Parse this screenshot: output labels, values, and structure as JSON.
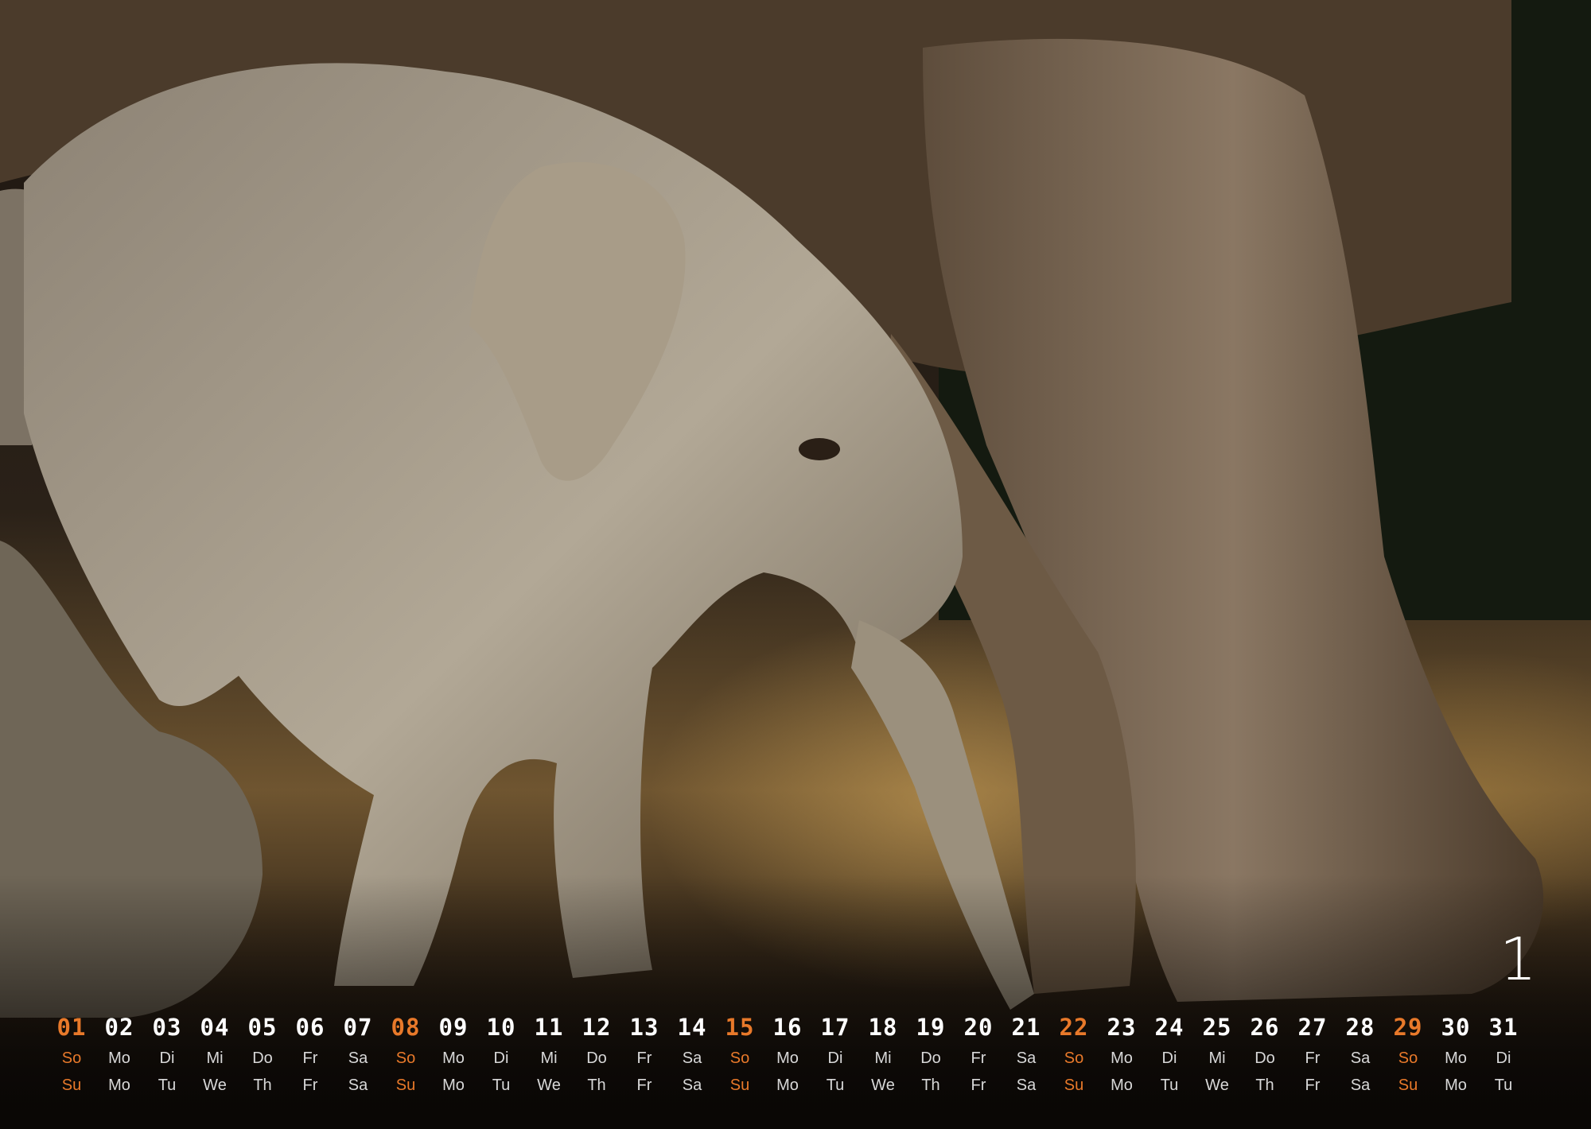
{
  "month_number": "1",
  "days": [
    {
      "num": "01",
      "de": "So",
      "en": "Su"
    },
    {
      "num": "02",
      "de": "Mo",
      "en": "Mo"
    },
    {
      "num": "03",
      "de": "Di",
      "en": "Tu"
    },
    {
      "num": "04",
      "de": "Mi",
      "en": "We"
    },
    {
      "num": "05",
      "de": "Do",
      "en": "Th"
    },
    {
      "num": "06",
      "de": "Fr",
      "en": "Fr"
    },
    {
      "num": "07",
      "de": "Sa",
      "en": "Sa"
    },
    {
      "num": "08",
      "de": "So",
      "en": "Su"
    },
    {
      "num": "09",
      "de": "Mo",
      "en": "Mo"
    },
    {
      "num": "10",
      "de": "Di",
      "en": "Tu"
    },
    {
      "num": "11",
      "de": "Mi",
      "en": "We"
    },
    {
      "num": "12",
      "de": "Do",
      "en": "Th"
    },
    {
      "num": "13",
      "de": "Fr",
      "en": "Fr"
    },
    {
      "num": "14",
      "de": "Sa",
      "en": "Sa"
    },
    {
      "num": "15",
      "de": "So",
      "en": "Su"
    },
    {
      "num": "16",
      "de": "Mo",
      "en": "Mo"
    },
    {
      "num": "17",
      "de": "Di",
      "en": "Tu"
    },
    {
      "num": "18",
      "de": "Mi",
      "en": "We"
    },
    {
      "num": "19",
      "de": "Do",
      "en": "Th"
    },
    {
      "num": "20",
      "de": "Fr",
      "en": "Fr"
    },
    {
      "num": "21",
      "de": "Sa",
      "en": "Sa"
    },
    {
      "num": "22",
      "de": "So",
      "en": "Su"
    },
    {
      "num": "23",
      "de": "Mo",
      "en": "Mo"
    },
    {
      "num": "24",
      "de": "Di",
      "en": "Tu"
    },
    {
      "num": "25",
      "de": "Mi",
      "en": "We"
    },
    {
      "num": "26",
      "de": "Do",
      "en": "Th"
    },
    {
      "num": "27",
      "de": "Fr",
      "en": "Fr"
    },
    {
      "num": "28",
      "de": "Sa",
      "en": "Sa"
    },
    {
      "num": "29",
      "de": "So",
      "en": "Su"
    },
    {
      "num": "30",
      "de": "Mo",
      "en": "Mo"
    },
    {
      "num": "31",
      "de": "Di",
      "en": "Tu"
    }
  ],
  "colors": {
    "sunday_accent": "#e8792a",
    "day_number": "#ffffff",
    "weekday_text": "#d8d8d8"
  }
}
